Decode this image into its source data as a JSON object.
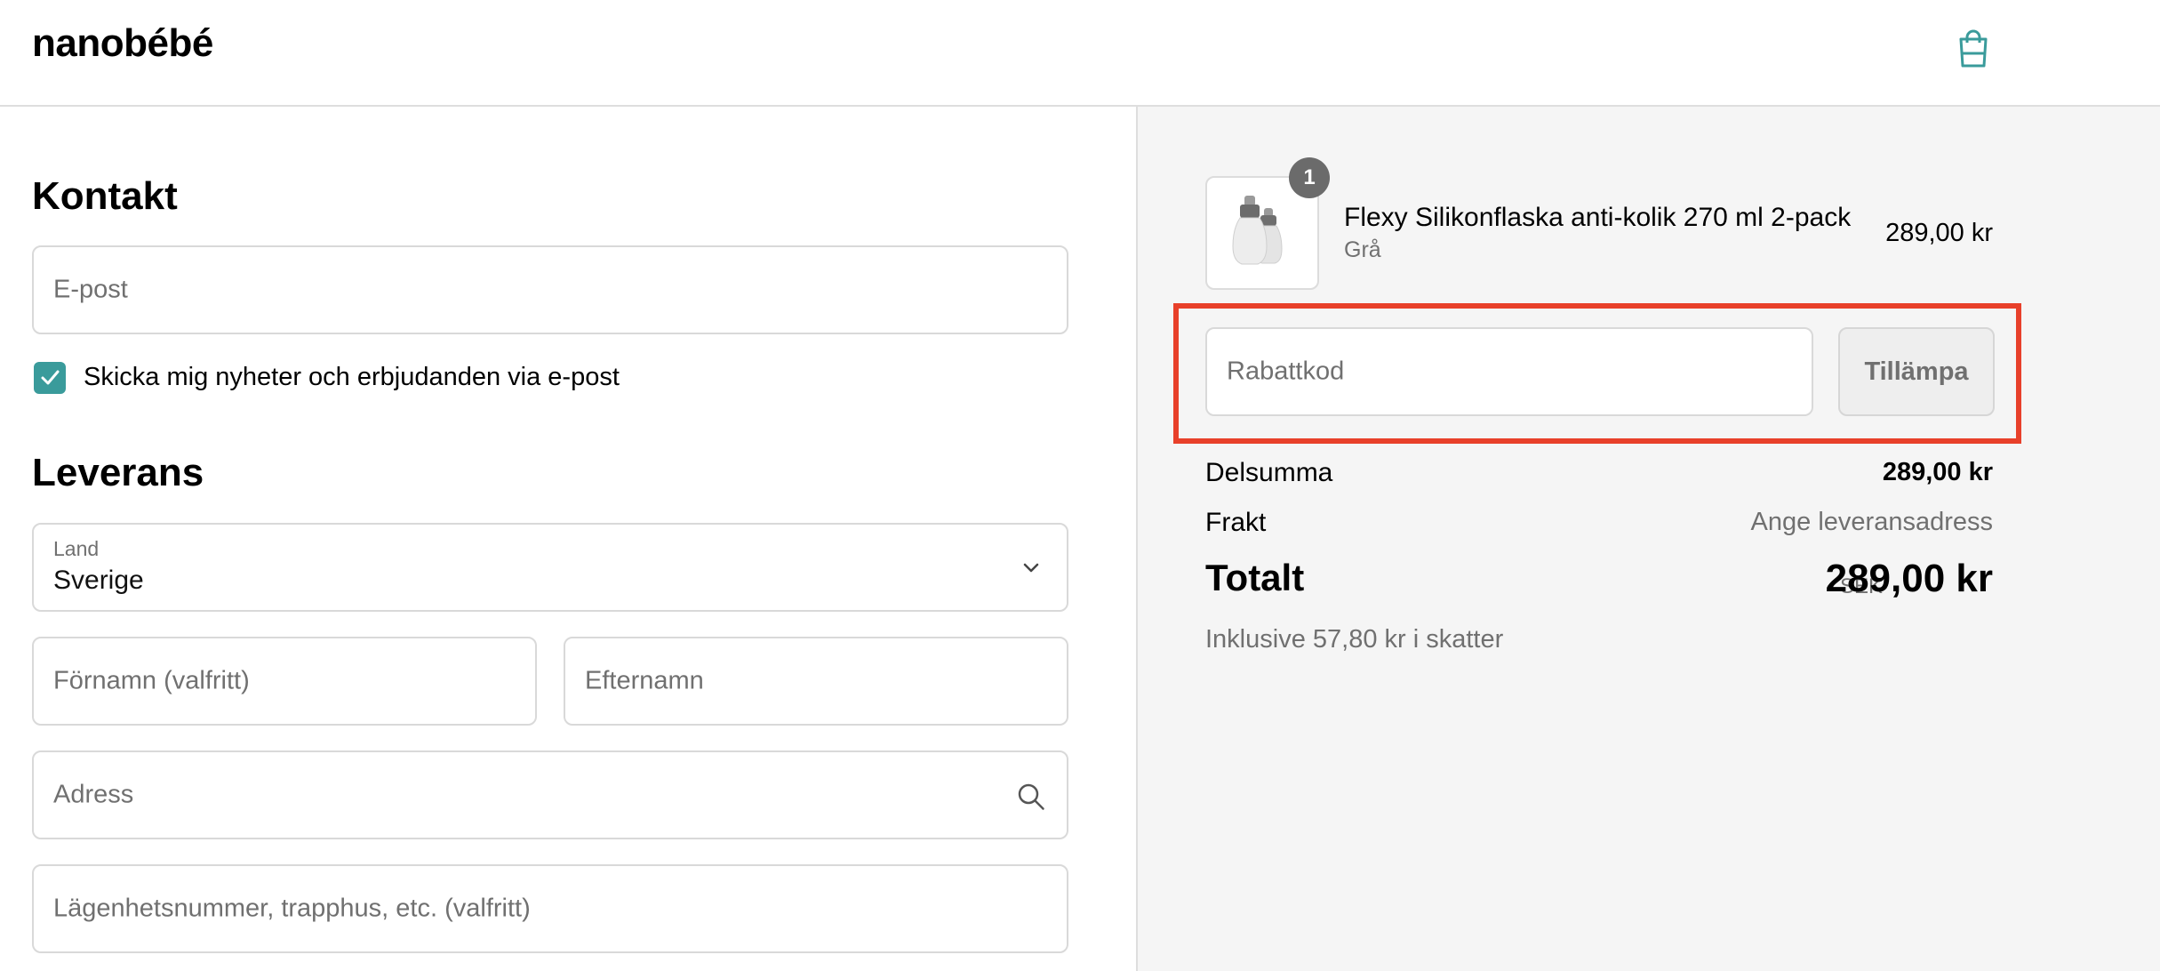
{
  "header": {
    "logo": "nanobébé",
    "cart_icon": "shopping-bag-icon",
    "accent": "#3a9b9b"
  },
  "contact": {
    "heading": "Kontakt",
    "email_placeholder": "E-post",
    "newsletter_checked": true,
    "newsletter_label": "Skicka mig nyheter och erbjudanden via e-post"
  },
  "delivery": {
    "heading": "Leverans",
    "country_label": "Land",
    "country_value": "Sverige",
    "first_name_placeholder": "Förnamn (valfritt)",
    "last_name_placeholder": "Efternamn",
    "address_placeholder": "Adress",
    "apartment_placeholder": "Lägenhetsnummer, trapphus, etc. (valfritt)"
  },
  "order": {
    "item": {
      "quantity": "1",
      "name": "Flexy Silikonflaska anti-kolik 270 ml 2-pack",
      "variant": "Grå",
      "price": "289,00 kr"
    },
    "discount_placeholder": "Rabattkod",
    "apply_label": "Tillämpa",
    "subtotal_label": "Delsumma",
    "subtotal_value": "289,00 kr",
    "shipping_label": "Frakt",
    "shipping_value": "Ange leveransadress",
    "total_label": "Totalt",
    "total_currency": "SEK",
    "total_value": "289,00 kr",
    "tax_note": "Inklusive 57,80 kr i skatter",
    "highlight_color": "#e8402a"
  }
}
